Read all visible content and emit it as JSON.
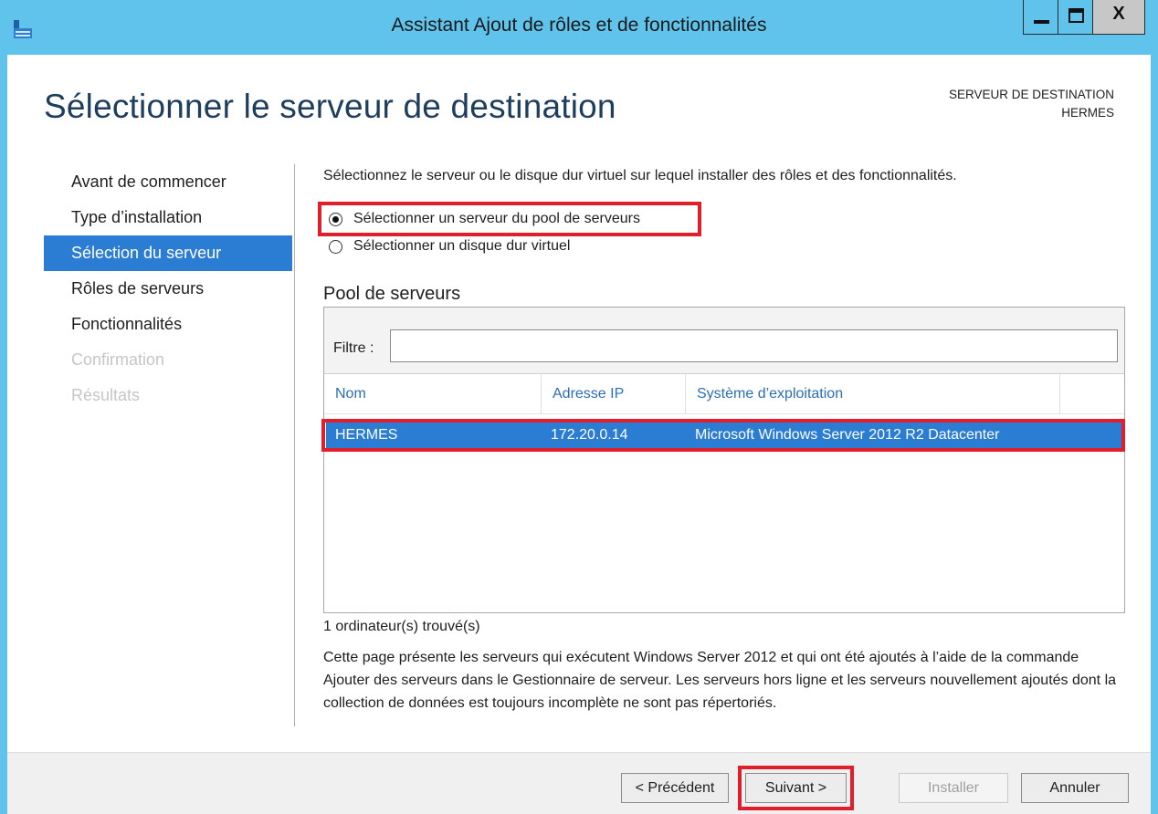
{
  "window": {
    "title": "Assistant Ajout de rôles et de fonctionnalités",
    "close_label": "X"
  },
  "header": {
    "page_title": "Sélectionner le serveur de destination",
    "dest_label": "SERVEUR DE DESTINATION",
    "dest_server": "HERMES"
  },
  "nav": {
    "items": [
      {
        "label": "Avant de commencer",
        "state": "normal"
      },
      {
        "label": "Type d’installation",
        "state": "normal"
      },
      {
        "label": "Sélection du serveur",
        "state": "active"
      },
      {
        "label": "Rôles de serveurs",
        "state": "normal"
      },
      {
        "label": "Fonctionnalités",
        "state": "normal"
      },
      {
        "label": "Confirmation",
        "state": "disabled"
      },
      {
        "label": "Résultats",
        "state": "disabled"
      }
    ]
  },
  "main": {
    "instruction": "Sélectionnez le serveur ou le disque dur virtuel sur lequel installer des rôles et des fonctionnalités.",
    "radio_pool": "Sélectionner un serveur du pool de serveurs",
    "radio_vhd": "Sélectionner un disque dur virtuel",
    "selected_option": "pool",
    "pool_title": "Pool de serveurs",
    "filter_label": "Filtre :",
    "filter_value": "",
    "columns": [
      "Nom",
      "Adresse IP",
      "Système d’exploitation"
    ],
    "rows": [
      {
        "name": "HERMES",
        "ip": "172.20.0.14",
        "os": "Microsoft Windows Server 2012 R2 Datacenter"
      }
    ],
    "found_count": "1 ordinateur(s) trouvé(s)",
    "description": "Cette page présente les serveurs qui exécutent Windows Server 2012 et qui ont été ajoutés à l’aide de la commande Ajouter des serveurs dans le Gestionnaire de serveur. Les serveurs hors ligne et les serveurs nouvellement ajoutés dont la collection de données est toujours incomplète ne sont pas répertoriés."
  },
  "footer": {
    "previous": "< Précédent",
    "next": "Suivant >",
    "install": "Installer",
    "cancel": "Annuler"
  },
  "colors": {
    "titlebar": "#5fc3ec",
    "selection": "#2b7cd3",
    "highlight_box": "#e01e2c",
    "page_title": "#1e3e5e"
  }
}
